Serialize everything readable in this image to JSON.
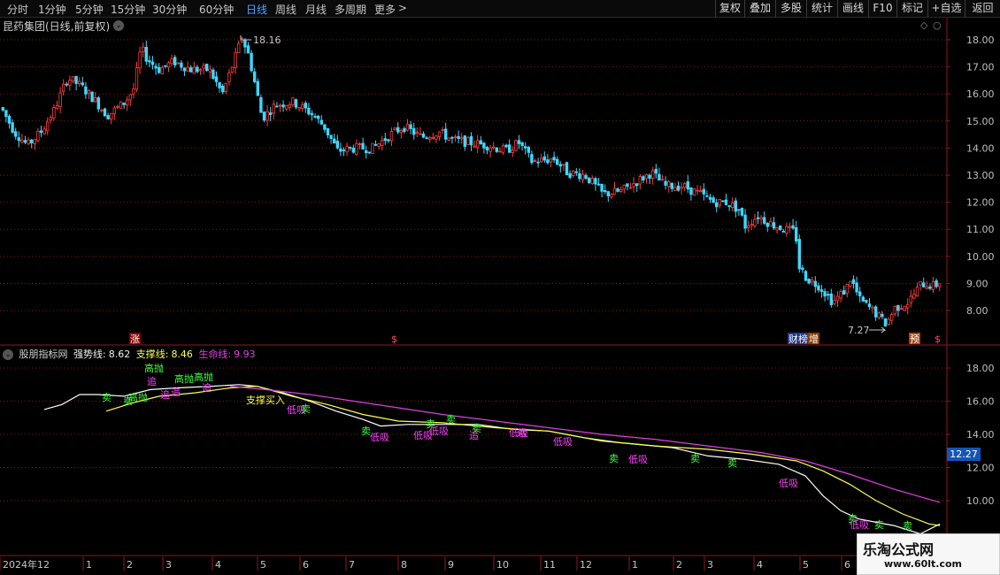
{
  "toolbar": {
    "timeframes": [
      "分时",
      "1分钟",
      "5分钟",
      "15分钟",
      "30分钟",
      "60分钟",
      "日线",
      "周线",
      "月线",
      "多周期",
      "更多"
    ],
    "more_arrow": ">",
    "right_buttons": [
      "复权",
      "叠加",
      "多股",
      "统计",
      "画线",
      "F10",
      "标记",
      "+自选",
      "返回"
    ]
  },
  "chart_title": "昆药集团(日线,前复权)",
  "main_chart": {
    "y_axis_ticks": [
      "18.00",
      "17.00",
      "16.00",
      "15.00",
      "14.00",
      "13.00",
      "12.00",
      "11.00",
      "10.00",
      "9.00",
      "8.00"
    ],
    "high_label": "18.16",
    "low_label": "7.27",
    "event_markers": [
      "涨",
      "$",
      "财",
      "榜",
      "增",
      "预",
      "$"
    ]
  },
  "indicator": {
    "name": "股朋指标网",
    "strong_label": "强势线:",
    "strong_value": "8.62",
    "support_label": "支撑线:",
    "support_value": "8.46",
    "life_label": "生命线:",
    "life_value": "9.93",
    "y_axis_ticks": [
      "18.00",
      "16.00",
      "14.00",
      "12.00",
      "10.00"
    ],
    "current_price": "12.27",
    "signal_labels": [
      "卖",
      "卖",
      "高抛",
      "高抛",
      "高抛",
      "追",
      "追",
      "追",
      "追",
      "高抛",
      "低吸",
      "支撑买入",
      "卖",
      "低吸",
      "卖",
      "卖",
      "低吸",
      "卖",
      "低吸",
      "追",
      "卖",
      "追",
      "低吸",
      "低吸",
      "卖",
      "低吸",
      "卖",
      "卖",
      "低吸",
      "卖",
      "低吸",
      "卖",
      "卖"
    ]
  },
  "x_axis": {
    "labels": [
      "2024年12",
      "1",
      "2",
      "3",
      "4",
      "5",
      "6",
      "7",
      "8",
      "9",
      "10",
      "11",
      "12",
      "1",
      "2",
      "3",
      "4",
      "5",
      "6"
    ]
  },
  "watermark": {
    "line1": "乐淘公式网",
    "line2": "www.60lt.com"
  },
  "colors": {
    "up": "#ff3c3c",
    "down": "#3cd8ff",
    "strong_line": "#ffff50",
    "support_line": "#ffffff",
    "life_line": "#e040e0",
    "signal_green": "#40ff40",
    "signal_magenta": "#ff40ff",
    "grid": "#8b1a1a"
  }
}
